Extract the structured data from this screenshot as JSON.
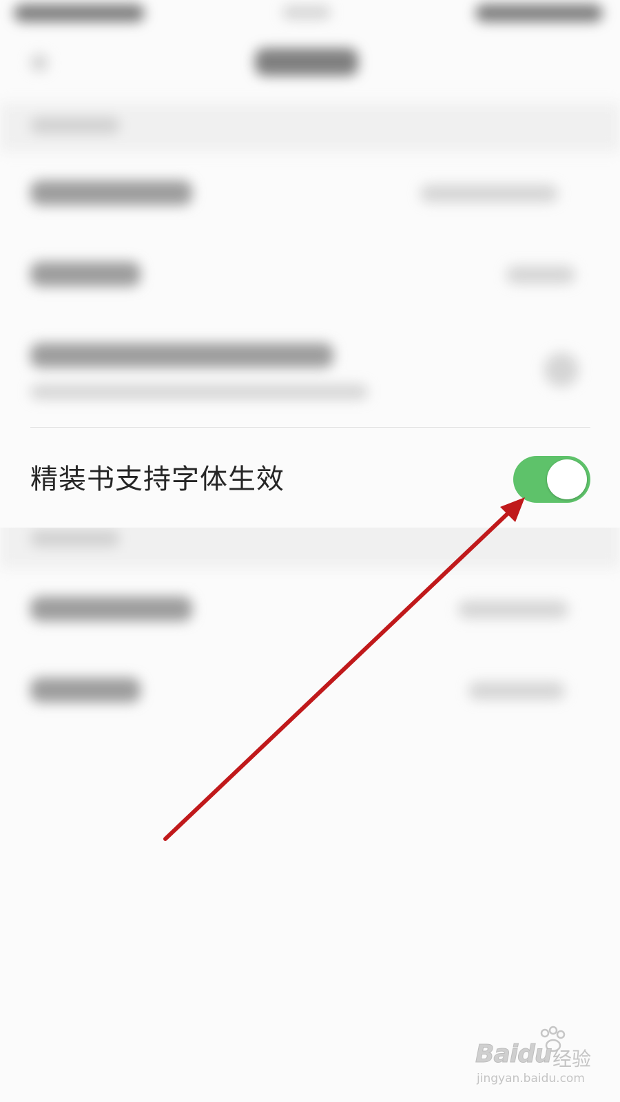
{
  "setting": {
    "label": "精装书支持字体生效",
    "toggle_state": "on",
    "toggle_color": "#5ec26a"
  },
  "annotation": {
    "arrow_color": "#c0191b"
  },
  "watermark": {
    "logo_text": "Baidu",
    "cn_text": "经验",
    "url_text": "jingyan.baidu.com"
  },
  "icons": [
    "back-arrow-icon",
    "paw-logo-icon"
  ]
}
